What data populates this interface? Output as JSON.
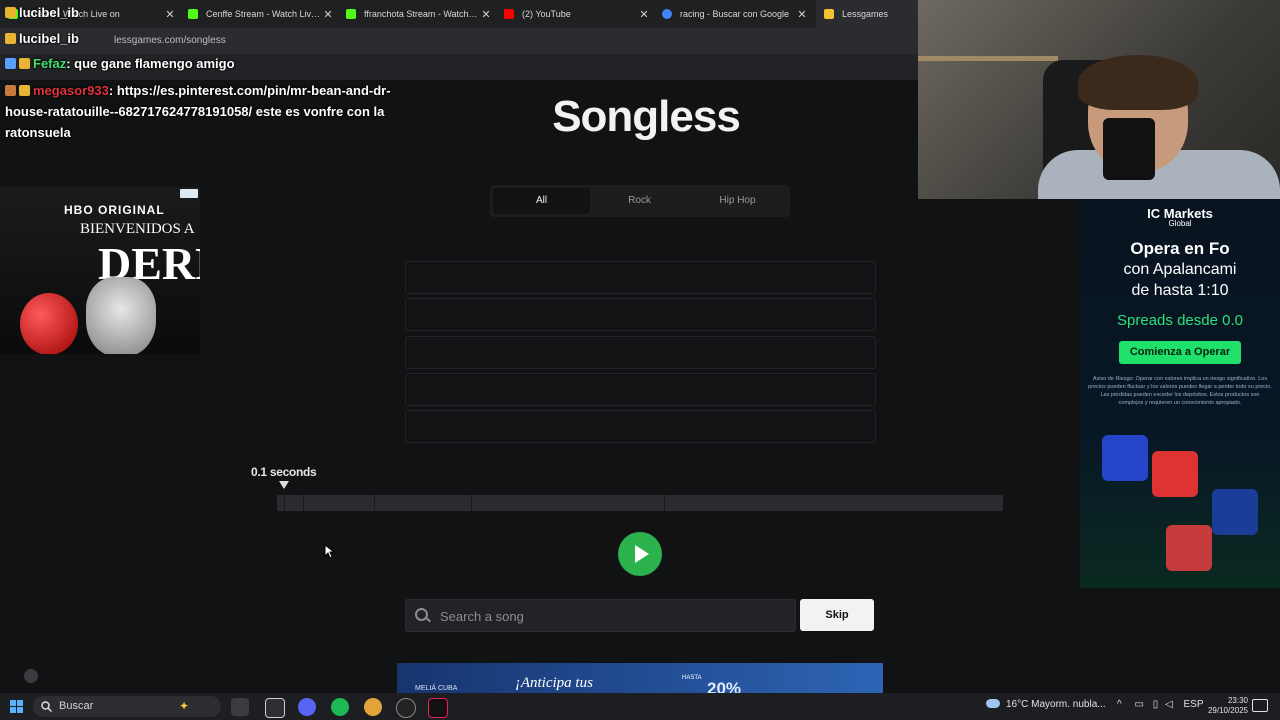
{
  "browser": {
    "tabs": [
      {
        "label": "Stream - Watch Live on",
        "color": "#53fc18"
      },
      {
        "label": "Cenffe Stream - Watch Live on",
        "color": "#53fc18"
      },
      {
        "label": "ffranchota Stream - Watch Live",
        "color": "#53fc18"
      },
      {
        "label": "(2) YouTube",
        "color": "#ff0000"
      },
      {
        "label": "racing - Buscar con Google",
        "color": "#4285f4"
      },
      {
        "label": "Lessgames",
        "color": "#f2c230"
      }
    ],
    "url": "lessgames.com/songless"
  },
  "chat": {
    "line1_user": "lucibel_ib",
    "line2_user": "lucibel_ib",
    "line3_user": "Fefaz",
    "line3_msg": ": que gane flamengo amigo",
    "line4_user": "megasor933",
    "line4_msg": ": https://es.pinterest.com/pin/mr-bean-and-dr-house-ratatouille--682717624778191058/ este es vonfre con la ratonsuela"
  },
  "songless": {
    "logo": "Songless",
    "genres": [
      "All",
      "Rock",
      "Hip Hop"
    ],
    "selected_genre": "All",
    "guess_slots": 5,
    "seconds_label": "0.1 seconds",
    "search_placeholder": "Search a song",
    "skip_label": "Skip",
    "timeline_segments": [
      0.1,
      0.5,
      2,
      4,
      8,
      16
    ]
  },
  "ads": {
    "hbo": {
      "brand": "HBO ORIGINAL",
      "line1": "BIENVENIDOS A",
      "title": "DERRY"
    },
    "icmarkets": {
      "brand": "IC Markets",
      "brand_sub": "Global",
      "headline1": "Opera en Fo",
      "headline2": "con Apalancami",
      "headline3": "de hasta 1:10",
      "spreads": "Spreads desde 0.0",
      "cta": "Comienza a Operar",
      "disclaimer": "Aviso de Riesgo: Operar con valores implica un riesgo significativo. Los precios pueden fluctuar y los valores pueden llegar a perder todo su precio. Las pérdidas pueden exceder los depósitos. Estos productos son complejos y requieren un conocimiento apropiado."
    },
    "bottom": {
      "brand": "MELIÁ CUBA",
      "text": "¡Anticipa tus",
      "hasta": "HASTA",
      "pct": "20%"
    }
  },
  "taskbar": {
    "search_label": "Buscar",
    "weather": "16°C  Mayorm. nubla...",
    "lang": "ESP",
    "time": "23:30",
    "date": "29/10/2025"
  }
}
